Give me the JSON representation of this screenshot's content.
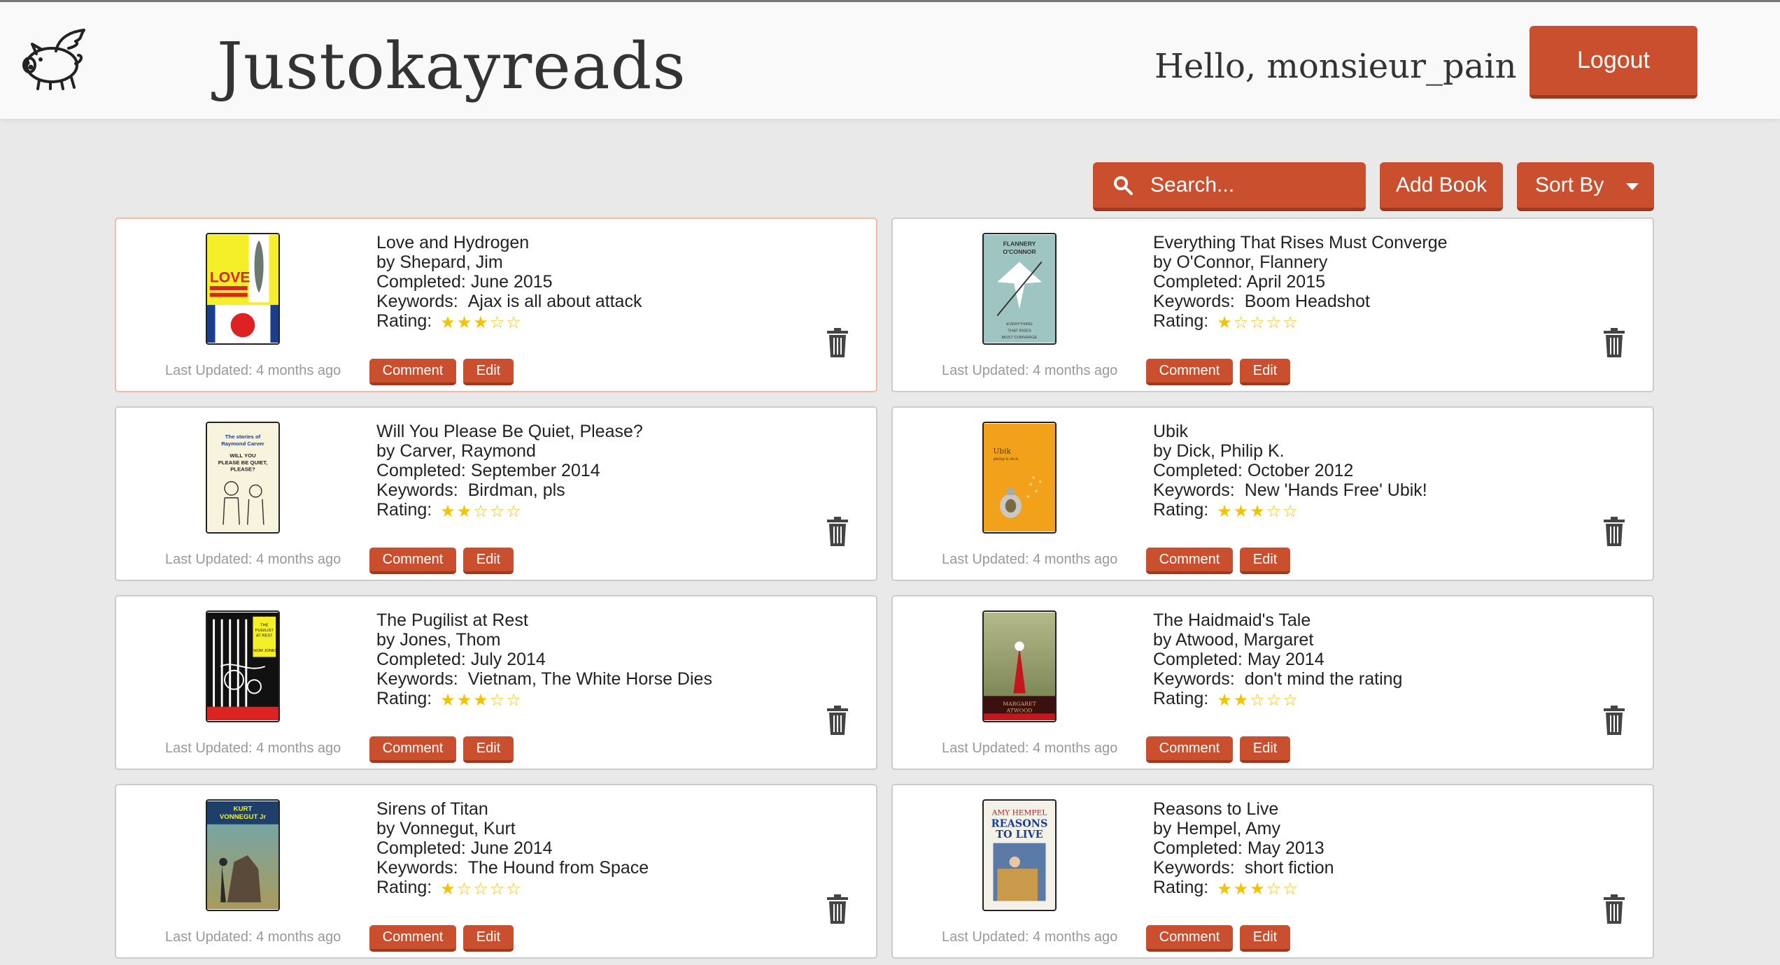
{
  "header": {
    "brand": "Justokayreads",
    "greeting": "Hello, monsieur_pain",
    "logout_label": "Logout",
    "logo_icon": "flying-pig-icon"
  },
  "toolbar": {
    "search_placeholder": "Search...",
    "add_label": "Add Book",
    "sort_label": "Sort By"
  },
  "labels": {
    "completed": "Completed:",
    "keywords": "Keywords:",
    "rating": "Rating:",
    "comment": "Comment",
    "edit": "Edit"
  },
  "colors": {
    "accent": "#c94f2f",
    "star": "#f3c300"
  },
  "books": [
    {
      "title": "Love and Hydrogen",
      "author": "by Shepard, Jim",
      "completed": "June 2015",
      "keywords": "Ajax is all about attack",
      "rating": 3,
      "updated": "Last Updated: 4 months ago"
    },
    {
      "title": "Everything That Rises Must Converge",
      "author": "by O'Connor, Flannery",
      "completed": "April 2015",
      "keywords": "Boom Headshot",
      "rating": 1,
      "updated": "Last Updated: 4 months ago"
    },
    {
      "title": "Will You Please Be Quiet, Please?",
      "author": "by Carver, Raymond",
      "completed": "September 2014",
      "keywords": "Birdman, pls",
      "rating": 2,
      "updated": "Last Updated: 4 months ago"
    },
    {
      "title": "Ubik",
      "author": "by Dick, Philip K.",
      "completed": "October 2012",
      "keywords": "New 'Hands Free' Ubik!",
      "rating": 3,
      "updated": "Last Updated: 4 months ago"
    },
    {
      "title": "The Pugilist at Rest",
      "author": "by Jones, Thom",
      "completed": "July 2014",
      "keywords": "Vietnam, The White Horse Dies",
      "rating": 3,
      "updated": "Last Updated: 4 months ago"
    },
    {
      "title": "The Haidmaid's Tale",
      "author": "by Atwood, Margaret",
      "completed": "May 2014",
      "keywords": "don't mind the rating",
      "rating": 2,
      "updated": "Last Updated: 4 months ago"
    },
    {
      "title": "Sirens of Titan",
      "author": "by Vonnegut, Kurt",
      "completed": "June 2014",
      "keywords": "The Hound from Space",
      "rating": 1,
      "updated": "Last Updated: 4 months ago"
    },
    {
      "title": "Reasons to Live",
      "author": "by Hempel, Amy",
      "completed": "May 2013",
      "keywords": "short fiction",
      "rating": 3,
      "updated": "Last Updated: 4 months ago"
    }
  ]
}
